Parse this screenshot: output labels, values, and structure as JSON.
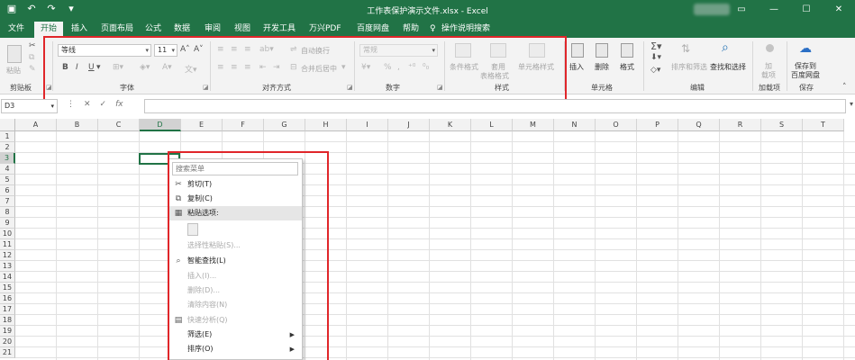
{
  "window": {
    "title": "工作表保护演示文件.xlsx  -  Excel",
    "qat": [
      "save-icon",
      "undo-icon",
      "redo-icon",
      "customize-icon"
    ]
  },
  "tabs": [
    {
      "label": "文件",
      "active": false
    },
    {
      "label": "开始",
      "active": true
    },
    {
      "label": "插入",
      "active": false
    },
    {
      "label": "页面布局",
      "active": false
    },
    {
      "label": "公式",
      "active": false
    },
    {
      "label": "数据",
      "active": false
    },
    {
      "label": "审阅",
      "active": false
    },
    {
      "label": "视图",
      "active": false
    },
    {
      "label": "开发工具",
      "active": false
    },
    {
      "label": "万兴PDF",
      "active": false
    },
    {
      "label": "百度网盘",
      "active": false
    },
    {
      "label": "帮助",
      "active": false
    },
    {
      "label": "操作说明搜索",
      "active": false
    }
  ],
  "ribbon": {
    "clipboard": {
      "label": "剪贴板",
      "paste": "粘贴"
    },
    "font": {
      "label": "字体",
      "name": "等线",
      "size": "11"
    },
    "alignment": {
      "label": "对齐方式",
      "wrap": "自动换行",
      "merge": "合并后居中"
    },
    "number": {
      "label": "数字",
      "format": "常规"
    },
    "styles": {
      "label": "样式",
      "cond": "条件格式",
      "table1": "套用",
      "table2": "表格格式",
      "cell": "单元格样式"
    },
    "cells": {
      "label": "单元格",
      "insert": "插入",
      "delete": "删除",
      "format": "格式"
    },
    "editing": {
      "label": "编辑",
      "sort": "排序和筛选",
      "find": "查找和选择"
    },
    "addins": {
      "label": "加载项",
      "btn1": "加",
      "btn2": "载项"
    },
    "save": {
      "label": "保存",
      "btn1": "保存到",
      "btn2": "百度网盘"
    }
  },
  "formula_bar": {
    "name_box": "D3",
    "fx": "fx",
    "content": ""
  },
  "grid": {
    "columns": [
      "A",
      "B",
      "C",
      "D",
      "E",
      "F",
      "G",
      "H",
      "I",
      "J",
      "K",
      "L",
      "M",
      "N",
      "O",
      "P",
      "Q",
      "R",
      "S",
      "T"
    ],
    "rows": [
      "1",
      "2",
      "3",
      "4",
      "5",
      "6",
      "7",
      "8",
      "9",
      "10",
      "11",
      "12",
      "13",
      "14",
      "15",
      "16",
      "17",
      "18",
      "19",
      "20",
      "21"
    ],
    "selected_column": "D",
    "selected_row": "3"
  },
  "context_menu": {
    "search_placeholder": "搜索菜单",
    "items": [
      {
        "label": "剪切(T)",
        "icon": "scissors-icon",
        "disabled": false
      },
      {
        "label": "复制(C)",
        "icon": "copy-icon",
        "disabled": false
      },
      {
        "label": "粘贴选项:",
        "icon": "paste-icon",
        "disabled": false
      },
      {
        "label": "选择性粘贴(S)...",
        "icon": "",
        "disabled": true
      },
      {
        "label": "智能查找(L)",
        "icon": "search-icon",
        "disabled": false
      },
      {
        "label": "插入(I)...",
        "icon": "",
        "disabled": true
      },
      {
        "label": "删除(D)...",
        "icon": "",
        "disabled": true
      },
      {
        "label": "清除内容(N)",
        "icon": "",
        "disabled": true
      },
      {
        "label": "快速分析(Q)",
        "icon": "quick-analysis-icon",
        "disabled": true
      },
      {
        "label": "筛选(E)",
        "icon": "",
        "disabled": false
      },
      {
        "label": "排序(O)",
        "icon": "",
        "disabled": false
      }
    ]
  },
  "colors": {
    "excel_green": "#217346",
    "annotation_red": "#e0262a"
  }
}
